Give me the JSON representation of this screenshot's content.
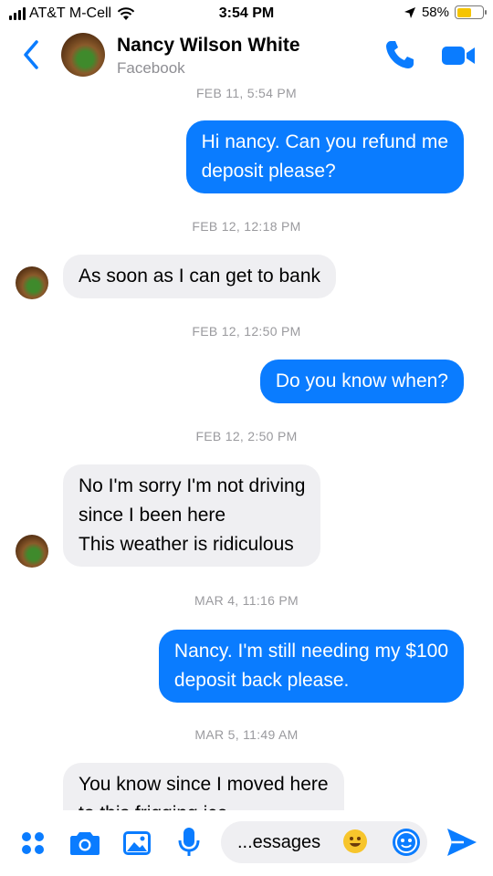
{
  "status_bar": {
    "carrier": "AT&T M-Cell",
    "time": "3:54 PM",
    "battery": "58%",
    "battery_level": 0.58
  },
  "header": {
    "contact_name": "Nancy Wilson White",
    "contact_source": "Facebook"
  },
  "messages": [
    {
      "timestamp": "FEB 11, 5:54 PM",
      "direction": "outgoing",
      "lines": [
        "Hi nancy. Can you refund me",
        "deposit please?"
      ]
    },
    {
      "timestamp": "FEB 12, 12:18 PM",
      "direction": "incoming",
      "lines": [
        "As soon as I can get to bank"
      ]
    },
    {
      "timestamp": "FEB 12, 12:50 PM",
      "direction": "outgoing",
      "lines": [
        "Do you know when?"
      ]
    },
    {
      "timestamp": "FEB 12, 2:50 PM",
      "direction": "incoming",
      "lines": [
        "No I'm sorry I'm not driving",
        "since I been here",
        "This weather is ridiculous"
      ]
    },
    {
      "timestamp": "MAR 4, 11:16 PM",
      "direction": "outgoing",
      "lines": [
        "Nancy. I'm still needing my $100",
        "deposit back please."
      ]
    },
    {
      "timestamp": "MAR 5, 11:49 AM",
      "direction": "incoming",
      "lines": [
        "You know since I moved here",
        "to this frigging ice"
      ]
    }
  ],
  "composer": {
    "input_text": "...essages"
  },
  "colors": {
    "accent": "#0a7cff",
    "incoming_bubble": "#efeff2",
    "timestamp": "#9a9a9e"
  },
  "icons": [
    "signal-icon",
    "wifi-icon",
    "location-icon",
    "battery-icon",
    "back-icon",
    "phone-icon",
    "video-icon",
    "apps-icon",
    "camera-icon",
    "photo-icon",
    "microphone-icon",
    "emoji-icon",
    "sticker-icon",
    "send-icon"
  ]
}
